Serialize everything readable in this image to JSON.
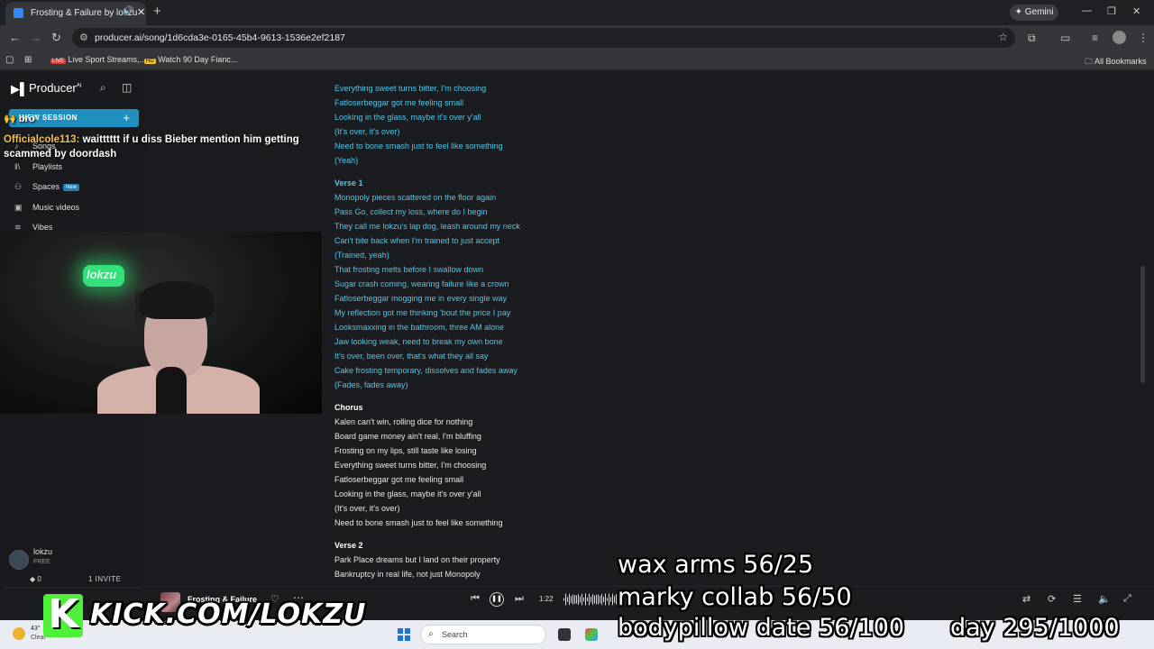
{
  "browser": {
    "tab_title": "Frosting & Failure by lokzu",
    "tab_audio_icon": "speaker-icon",
    "tab_close": "✕",
    "new_tab": "+",
    "gemini_label": "Gemini",
    "url": "producer.ai/song/1d6cda3e-0165-45b4-9613-1536e2ef2187",
    "bookmarks": [
      {
        "label": "Live Sport Streams,...",
        "badge": "LIVE"
      },
      {
        "label": "Watch 90 Day Fianc...",
        "badge": "HD"
      }
    ],
    "all_bookmarks": "All Bookmarks"
  },
  "sidebar": {
    "logo": "Producer",
    "logo_sup": "AI",
    "new_session": "NEW SESSION",
    "items": [
      {
        "label": "Songs",
        "icon": "music-note-icon"
      },
      {
        "label": "Playlists",
        "icon": "playlist-icon"
      },
      {
        "label": "Spaces",
        "icon": "spaces-icon",
        "badge": "New"
      },
      {
        "label": "Music videos",
        "icon": "film-icon"
      },
      {
        "label": "Vibes",
        "icon": "vibes-icon"
      }
    ],
    "user": {
      "name": "lokzu",
      "plan": "FREE"
    },
    "credits": "0",
    "invite": "1 INVITE"
  },
  "lyrics": [
    {
      "text": "Everything sweet turns bitter, I'm choosing",
      "kind": "line",
      "hl": true
    },
    {
      "text": "Fatloserbeggar got me feeling small",
      "kind": "line",
      "hl": true
    },
    {
      "text": "Looking in the glass, maybe it's over y'all",
      "kind": "line",
      "hl": true
    },
    {
      "text": "(It's over, it's over)",
      "kind": "line",
      "hl": true
    },
    {
      "text": "Need to bone smash just to feel like something",
      "kind": "line",
      "hl": true
    },
    {
      "text": "(Yeah)",
      "kind": "line",
      "hl": true
    },
    {
      "text": "Verse 1",
      "kind": "sec",
      "hl": true
    },
    {
      "text": "Monopoly pieces scattered on the floor again",
      "kind": "line",
      "hl": true
    },
    {
      "text": "Pass Go, collect my loss, where do I begin",
      "kind": "line",
      "hl": true
    },
    {
      "text": "They call me lokzu's lap dog, leash around my neck",
      "kind": "line",
      "hl": true
    },
    {
      "text": "Can't bite back when I'm trained to just accept",
      "kind": "line",
      "hl": true
    },
    {
      "text": "(Trained, yeah)",
      "kind": "line",
      "hl": true
    },
    {
      "text": "That frosting melts before I swallow down",
      "kind": "line",
      "hl": true
    },
    {
      "text": "Sugar crash coming, wearing failure like a crown",
      "kind": "line",
      "hl": true
    },
    {
      "text": "Fatloserbeggar mogging me in every single way",
      "kind": "line",
      "hl": true
    },
    {
      "text": "My reflection got me thinking 'bout the price I pay",
      "kind": "line",
      "hl": true
    },
    {
      "text": "Looksmaxxing in the bathroom, three AM alone",
      "kind": "line",
      "hl": true
    },
    {
      "text": "Jaw looking weak, need to break my own bone",
      "kind": "line",
      "hl": true
    },
    {
      "text": "It's over, been over, that's what they all say",
      "kind": "line",
      "hl": true
    },
    {
      "text": "Cake frosting temporary, dissolves and fades away",
      "kind": "line",
      "hl": true
    },
    {
      "text": "(Fades, fades away)",
      "kind": "line",
      "hl": true
    },
    {
      "text": "Chorus",
      "kind": "sec",
      "hl": false
    },
    {
      "text": "Kalen can't win, rolling dice for nothing",
      "kind": "line",
      "hl": false
    },
    {
      "text": "Board game money ain't real, I'm bluffing",
      "kind": "line",
      "hl": false
    },
    {
      "text": "Frosting on my lips, still taste like losing",
      "kind": "line",
      "hl": false
    },
    {
      "text": "Everything sweet turns bitter, I'm choosing",
      "kind": "line",
      "hl": false
    },
    {
      "text": "Fatloserbeggar got me feeling small",
      "kind": "line",
      "hl": false
    },
    {
      "text": "Looking in the glass, maybe it's over y'all",
      "kind": "line",
      "hl": false
    },
    {
      "text": "(It's over, it's over)",
      "kind": "line",
      "hl": false
    },
    {
      "text": "Need to bone smash just to feel like something",
      "kind": "line",
      "hl": false
    },
    {
      "text": "Verse 2",
      "kind": "sec",
      "hl": false
    },
    {
      "text": "Park Place dreams but I land on their property",
      "kind": "line",
      "hl": false
    },
    {
      "text": "Bankruptcy in real life, not just Monopoly",
      "kind": "line",
      "hl": false
    }
  ],
  "player": {
    "title": "Frosting & Failure",
    "time": "1:22"
  },
  "taskbar": {
    "temp": "43°",
    "condition": "Clear",
    "search_placeholder": "Search"
  },
  "overlay": {
    "chat_top": "bro",
    "chat_user": "Officialcole113:",
    "chat_message": "waitttttt if u diss Bieber mention him getting scammed by doordash",
    "goals": [
      "wax arms 56/25",
      "marky collab 56/50",
      "bodypillow date 56/100",
      "day 295/1000"
    ],
    "kick_url": "KICK.COM/LOKZU",
    "neon_sign": "lokzu"
  }
}
